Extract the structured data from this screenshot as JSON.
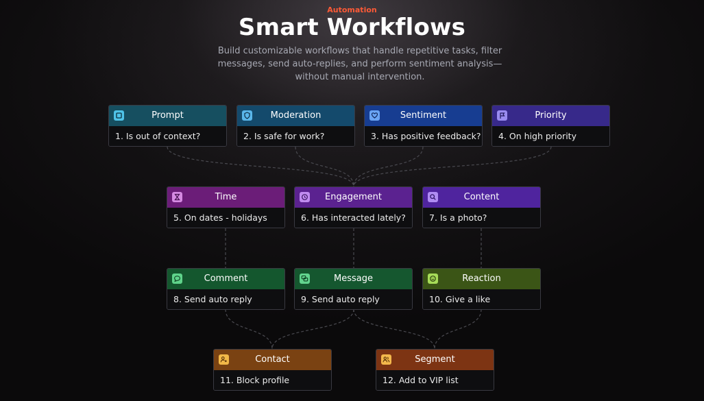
{
  "header": {
    "eyebrow": "Automation",
    "title": "Smart Workflows",
    "subtitle": "Build customizable workflows that handle repetitive tasks, filter messages, send auto-replies, and perform sentiment analysis—without manual intervention."
  },
  "nodes": [
    {
      "label": "Prompt",
      "step": "1. Is out of context?",
      "color": "#164f60",
      "icon_color": "#4fc3e8",
      "icon": "square-icon"
    },
    {
      "label": "Moderation",
      "step": "2. Is safe for work?",
      "color": "#144a6c",
      "icon_color": "#5ab6ea",
      "icon": "shield-icon"
    },
    {
      "label": "Sentiment",
      "step": "3. Has positive feedback?",
      "color": "#173d91",
      "icon_color": "#6aa4f3",
      "icon": "heart-icon"
    },
    {
      "label": "Priority",
      "step": "4. On high priority",
      "color": "#37298a",
      "icon_color": "#9a8cf0",
      "icon": "flag-icon"
    },
    {
      "label": "Time",
      "step": "5. On dates - holidays",
      "color": "#6b1d78",
      "icon_color": "#d58ae2",
      "icon": "hourglass-icon"
    },
    {
      "label": "Engagement",
      "step": "6. Has interacted lately?",
      "color": "#5b2290",
      "icon_color": "#c08bf0",
      "icon": "clock-icon"
    },
    {
      "label": "Content",
      "step": "7. Is a photo?",
      "color": "#4f249e",
      "icon_color": "#b08cf3",
      "icon": "search-icon"
    },
    {
      "label": "Comment",
      "step": "8. Send auto reply",
      "color": "#14572e",
      "icon_color": "#5fd38a",
      "icon": "comment-icon"
    },
    {
      "label": "Message",
      "step": "9. Send auto reply",
      "color": "#15572f",
      "icon_color": "#62d48e",
      "icon": "messages-icon"
    },
    {
      "label": "Reaction",
      "step": "10. Give a like",
      "color": "#3b5516",
      "icon_color": "#a6dc58",
      "icon": "smile-icon"
    },
    {
      "label": "Contact",
      "step": "11. Block profile",
      "color": "#7a4212",
      "icon_color": "#f2b848",
      "icon": "user-x-icon"
    },
    {
      "label": "Segment",
      "step": "12. Add to VIP list",
      "color": "#7d3413",
      "icon_color": "#f4b84c",
      "icon": "users-icon"
    }
  ]
}
